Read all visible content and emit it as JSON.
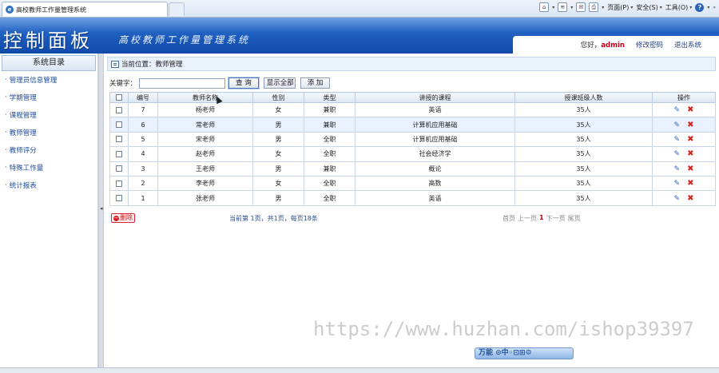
{
  "browser": {
    "tab_title": "高校教师工作量管理系统",
    "commands": {
      "page": "页面(P)",
      "safety": "安全(S)",
      "tools": "工具(O)"
    }
  },
  "header": {
    "brand": "控制面板",
    "system_name": "高校教师工作量管理系统",
    "greeting": "您好，",
    "username": "admin",
    "change_password": "修改密码",
    "logout": "退出系统"
  },
  "sidebar": {
    "title": "系统目录",
    "items": [
      {
        "label": "管理员信息管理"
      },
      {
        "label": "学期管理"
      },
      {
        "label": "课程管理"
      },
      {
        "label": "教师管理"
      },
      {
        "label": "教师评分"
      },
      {
        "label": "特殊工作量"
      },
      {
        "label": "统计报表"
      }
    ]
  },
  "main": {
    "location": "当前位置：教师管理",
    "keyword_label": "关键字：",
    "keyword_value": "",
    "buttons": {
      "query": "查 询",
      "show_all": "显示全部",
      "add": "添 加"
    },
    "table": {
      "headers": [
        "",
        "编号",
        "教师名称",
        "性别",
        "类型",
        "讲授的课程",
        "授课班级人数",
        "操作"
      ],
      "rows": [
        {
          "id": "7",
          "name": "杨老师",
          "gender": "女",
          "type": "兼职",
          "course": "英语",
          "students": "35人"
        },
        {
          "id": "6",
          "name": "常老师",
          "gender": "男",
          "type": "兼职",
          "course": "计算机应用基础",
          "students": "35人"
        },
        {
          "id": "5",
          "name": "宋老师",
          "gender": "男",
          "type": "全职",
          "course": "计算机应用基础",
          "students": "35人"
        },
        {
          "id": "4",
          "name": "赵老师",
          "gender": "女",
          "type": "全职",
          "course": "社会经济学",
          "students": "35人"
        },
        {
          "id": "3",
          "name": "王老师",
          "gender": "男",
          "type": "兼职",
          "course": "概论",
          "students": "35人"
        },
        {
          "id": "2",
          "name": "李老师",
          "gender": "女",
          "type": "全职",
          "course": "高数",
          "students": "35人"
        },
        {
          "id": "1",
          "name": "张老师",
          "gender": "男",
          "type": "全职",
          "course": "英语",
          "students": "35人"
        }
      ]
    },
    "delete_label": "删除",
    "page_info": "当前第 1页，共1页，每页18条",
    "pager": {
      "first": "首页",
      "prev": "上一页",
      "current": "1",
      "next": "下一页",
      "last": "尾页"
    }
  },
  "watermark": "https://www.huzhan.com/ishop39397",
  "badge": "万能 ⊙中◦⊡⊞⚙",
  "colors": {
    "banner": "#1f5fbf",
    "admin": "#c4001a",
    "delete": "#d4231d",
    "edit": "#2f63b6"
  }
}
